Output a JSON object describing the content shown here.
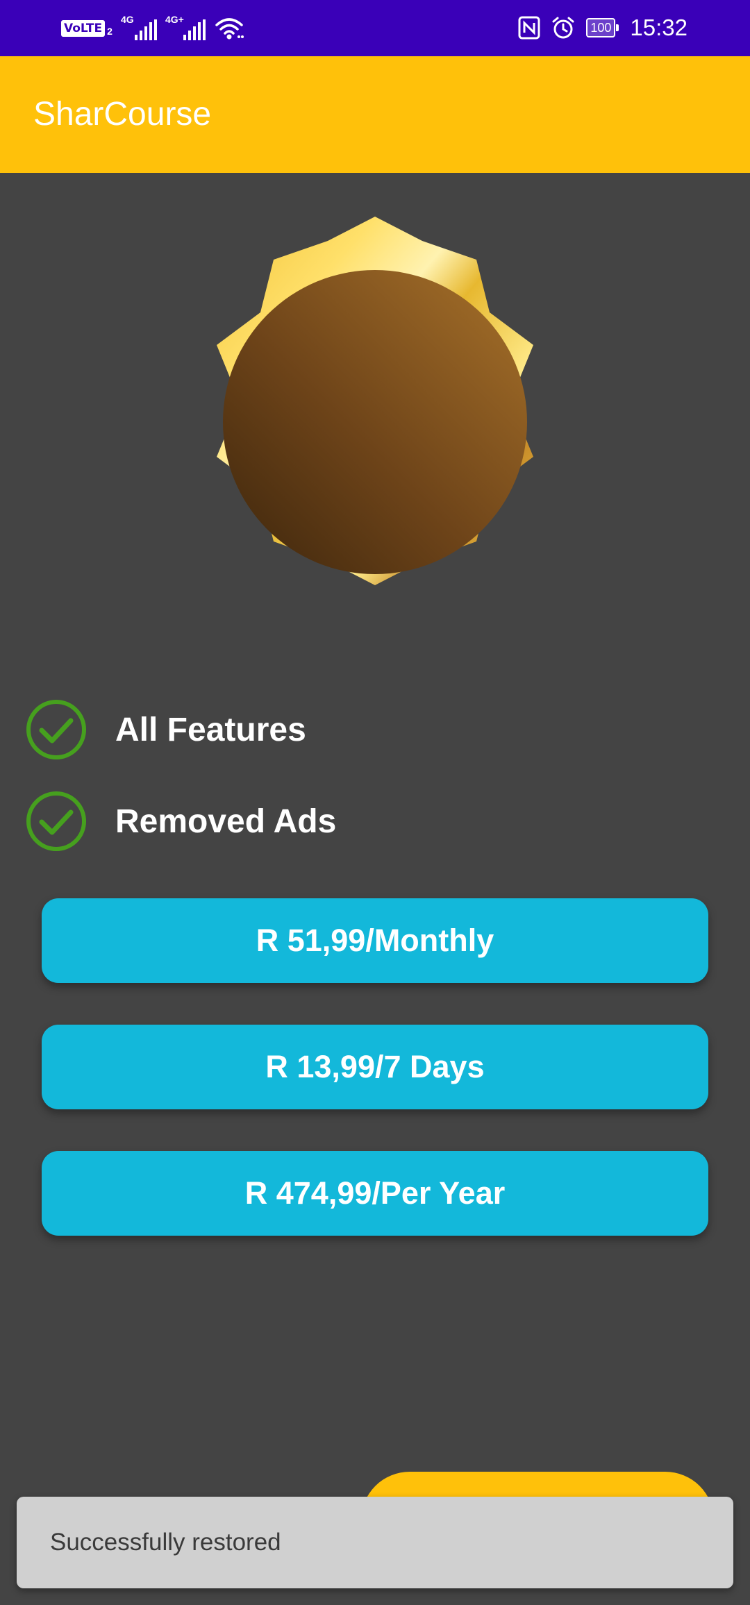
{
  "status_bar": {
    "volte_label": "VoLTE",
    "sim_number": "2",
    "network_1": "4G",
    "network_2": "4G+",
    "battery_level": "100",
    "time": "15:32",
    "icons": [
      "volte-icon",
      "signal-icon",
      "signal-icon",
      "wifi-icon",
      "nfc-icon",
      "alarm-icon",
      "battery-icon"
    ]
  },
  "app_bar": {
    "title": "SharCourse",
    "color": "#ffc10a"
  },
  "badge": {
    "icon": "premium-badge-icon"
  },
  "features": [
    {
      "label": "All Features",
      "icon": "check-circle-icon"
    },
    {
      "label": "Removed Ads",
      "icon": "check-circle-icon"
    }
  ],
  "plans": [
    {
      "label": "R 51,99/Monthly"
    },
    {
      "label": "R 13,99/7 Days"
    },
    {
      "label": "R 474,99/Per Year"
    }
  ],
  "snackbar": {
    "message": "Successfully restored"
  },
  "colors": {
    "status_bar": "#3a00b8",
    "background": "#444444",
    "button": "#13b8da",
    "check": "#46a01e",
    "snackbar": "#d0d0d0"
  }
}
